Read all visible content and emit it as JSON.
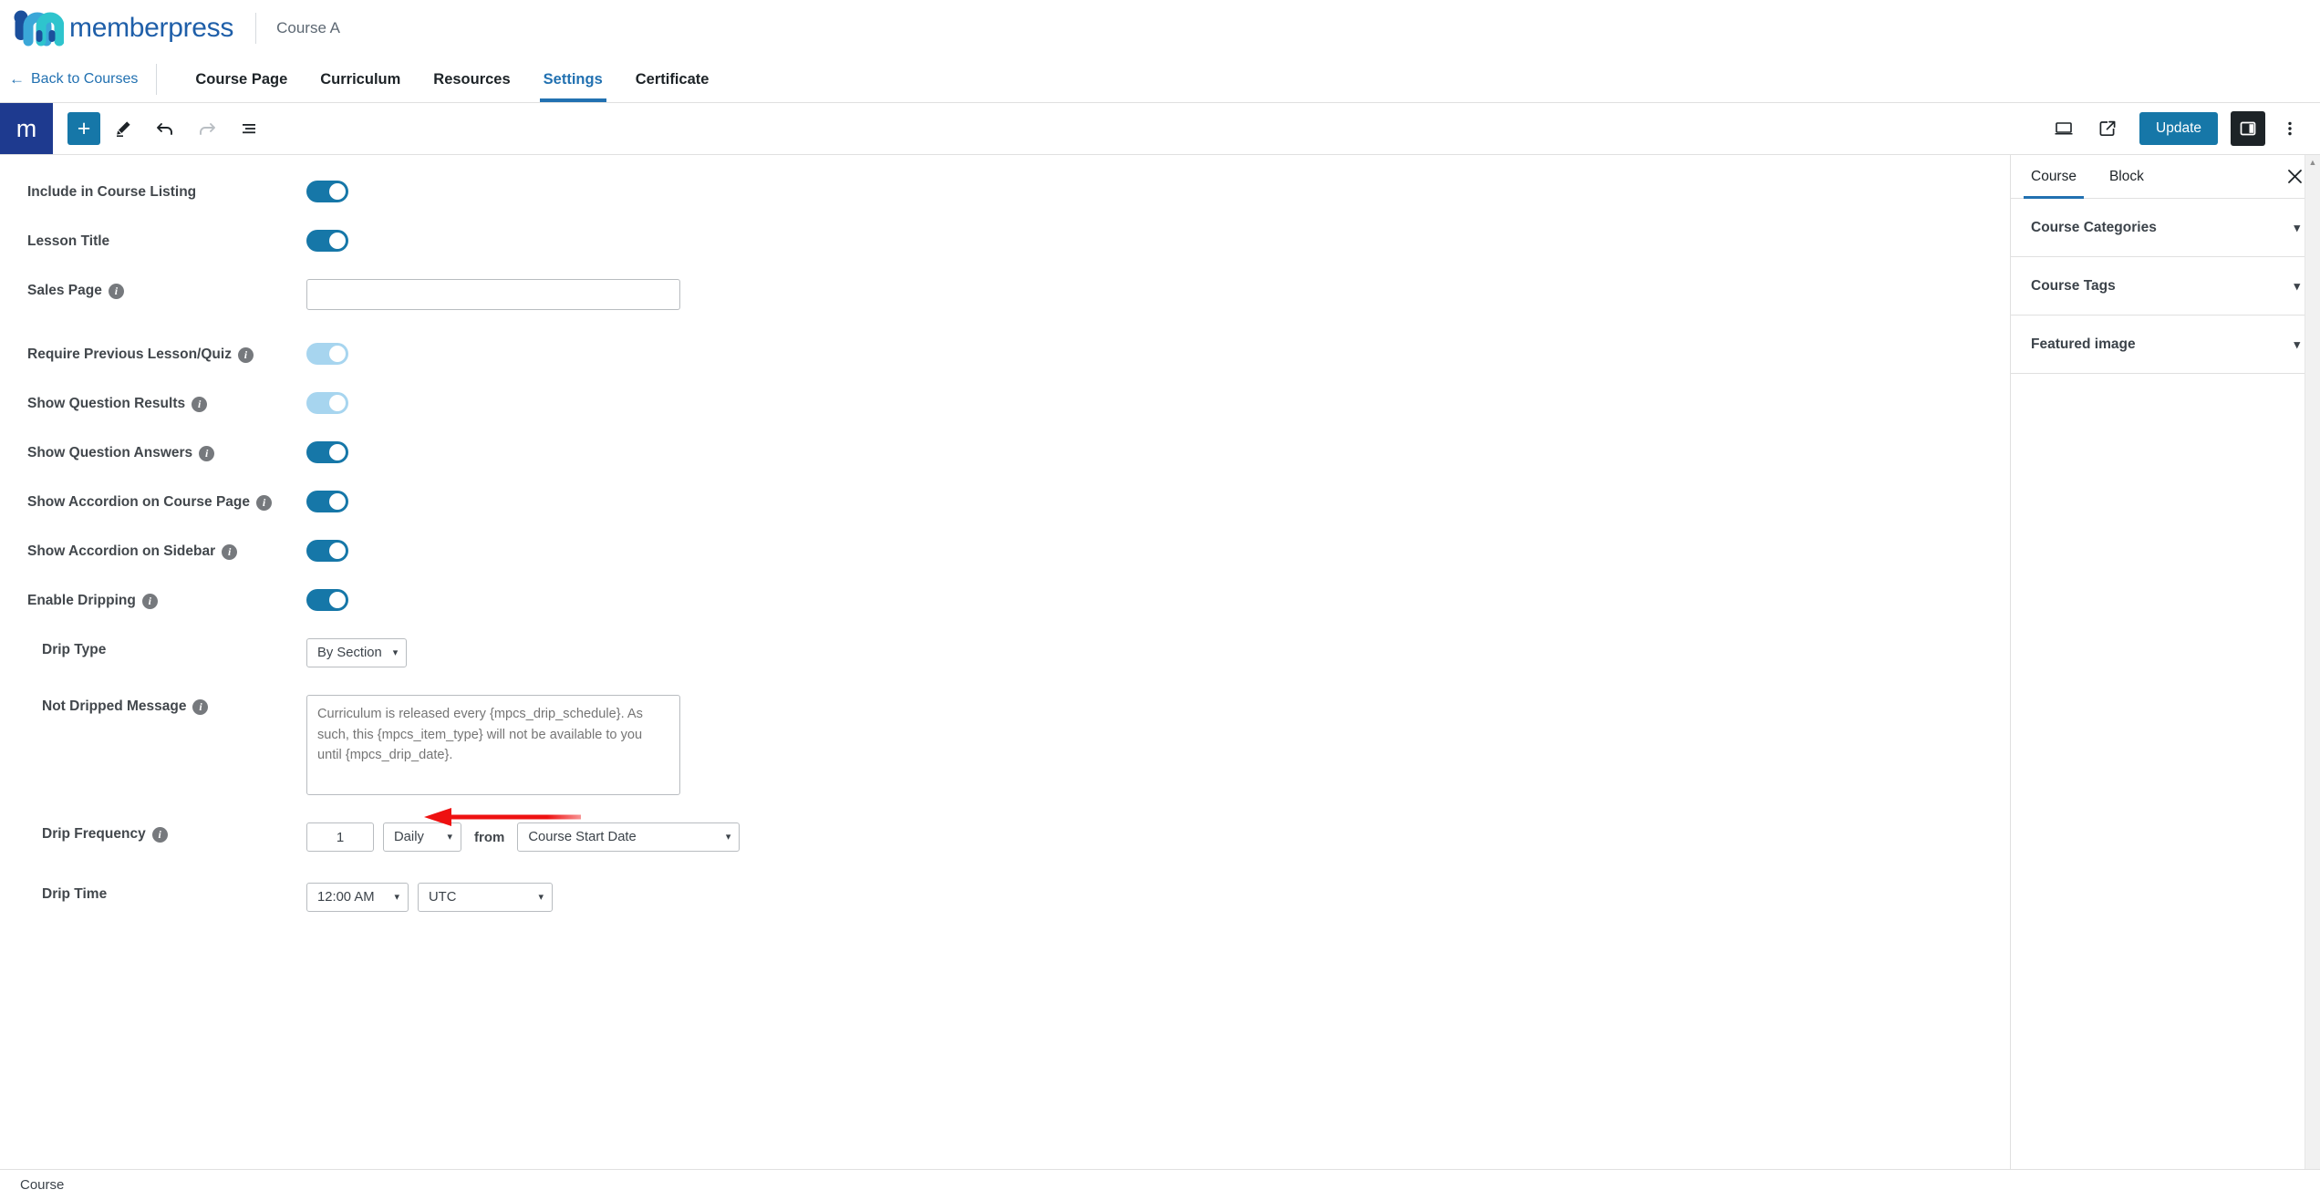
{
  "brand": {
    "logo_icon": "memberpress-m-logo",
    "name": "memberpress",
    "course_name": "Course A",
    "logo_dark_color": "#1b4f9c",
    "logo_teal_color": "#2ec4cd"
  },
  "nav": {
    "back_label": "Back to Courses",
    "back_arrow": "←",
    "tabs": [
      {
        "label": "Course Page",
        "active": false
      },
      {
        "label": "Curriculum",
        "active": false
      },
      {
        "label": "Resources",
        "active": false
      },
      {
        "label": "Settings",
        "active": true
      },
      {
        "label": "Certificate",
        "active": false
      }
    ]
  },
  "toolbar": {
    "logo_letter": "m",
    "add_label": "+",
    "edit_icon": "pencil-icon",
    "undo_icon": "undo-arrow-icon",
    "redo_icon": "redo-arrow-icon",
    "listview_icon": "list-view-icon",
    "view_icon": "desktop-view-icon",
    "preview_icon": "external-link-preview-icon",
    "update_label": "Update",
    "sidebar_toggle_icon": "settings-sidebar-icon",
    "options_icon": "three-dot-options-icon",
    "accent_color": "#1677a8",
    "logo_bg_color": "#1e3a8f"
  },
  "settings": {
    "rows": [
      {
        "label": "Include in Course Listing",
        "info": false,
        "type": "toggle",
        "on": true,
        "faded": false
      },
      {
        "label": "Lesson Title",
        "info": false,
        "type": "toggle",
        "on": true,
        "faded": false
      },
      {
        "label": "Sales Page",
        "info": true,
        "type": "text",
        "value": "",
        "placeholder": ""
      },
      {
        "label": "Require Previous Lesson/Quiz",
        "info": true,
        "type": "toggle",
        "on": true,
        "faded": true
      },
      {
        "label": "Show Question Results",
        "info": true,
        "type": "toggle",
        "on": true,
        "faded": true
      },
      {
        "label": "Show Question Answers",
        "info": true,
        "type": "toggle",
        "on": true,
        "faded": false
      },
      {
        "label": "Show Accordion on Course Page",
        "info": true,
        "type": "toggle",
        "on": true,
        "faded": false
      },
      {
        "label": "Show Accordion on Sidebar",
        "info": true,
        "type": "toggle",
        "on": true,
        "faded": false
      },
      {
        "label": "Enable Dripping",
        "info": true,
        "type": "toggle",
        "on": true,
        "faded": false
      }
    ],
    "drip_type": {
      "label": "Drip Type",
      "info": false,
      "value": "By Section"
    },
    "not_dripped_message": {
      "label": "Not Dripped Message",
      "info": true,
      "placeholder": "Curriculum is released every {mpcs_drip_schedule}. As such, this {mpcs_item_type} will not be available to you until {mpcs_drip_date}."
    },
    "drip_frequency": {
      "label": "Drip Frequency",
      "info": true,
      "amount": "1",
      "unit": "Daily",
      "from_word": "from",
      "reference": "Course Start Date"
    },
    "drip_time": {
      "label": "Drip Time",
      "info": false,
      "time": "12:00 AM",
      "timezone": "UTC"
    }
  },
  "annotation": {
    "type": "arrow",
    "color": "#ee1111",
    "points_to": "drip-type-select"
  },
  "sidebar": {
    "tabs": [
      {
        "label": "Course",
        "active": true
      },
      {
        "label": "Block",
        "active": false
      }
    ],
    "close_icon": "close-icon",
    "panels": [
      {
        "label": "Course Categories",
        "expanded": false
      },
      {
        "label": "Course Tags",
        "expanded": false
      },
      {
        "label": "Featured image",
        "expanded": false
      }
    ],
    "chevron_icon": "chevron-down-icon"
  },
  "statusbar": {
    "label": "Course"
  }
}
